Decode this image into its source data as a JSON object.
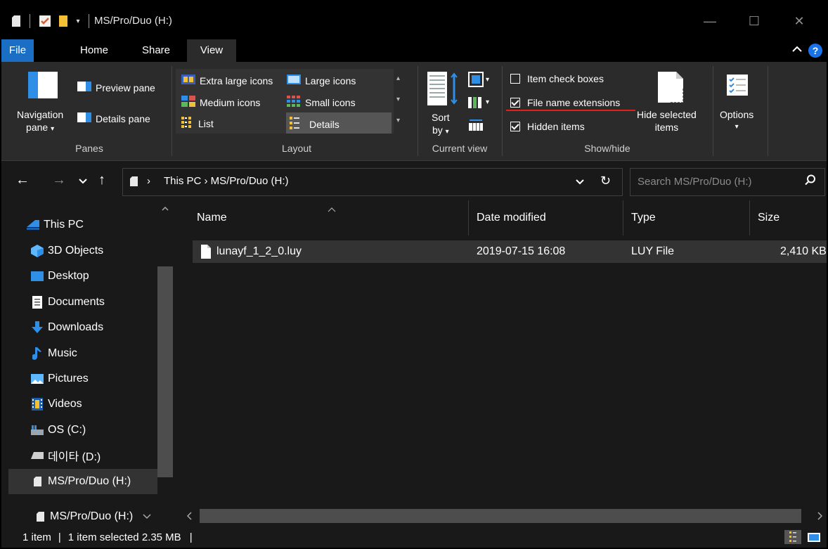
{
  "window": {
    "title": "MS/Pro/Duo (H:)",
    "minimize_glyph": "—",
    "maximize_glyph": "☐",
    "close_glyph": "✕"
  },
  "ribbon_tabs": [
    "File",
    "Home",
    "Share",
    "View"
  ],
  "ribbon_active_tab": "View",
  "ribbon_collapse_glyph": "^",
  "help_glyph": "?",
  "panes": {
    "label": "Panes",
    "navigation_pane_line1": "Navigation",
    "navigation_pane_line2": "pane",
    "preview_pane": "Preview pane",
    "details_pane": "Details pane"
  },
  "layout": {
    "label": "Layout",
    "extra_large": "Extra large icons",
    "large": "Large icons",
    "medium": "Medium icons",
    "small": "Small icons",
    "list": "List",
    "details": "Details"
  },
  "current_view": {
    "label": "Current view",
    "sort_line1": "Sort",
    "sort_line2": "by"
  },
  "show_hide": {
    "label": "Show/hide",
    "item_check_boxes": "Item check boxes",
    "file_name_extensions": "File name extensions",
    "hidden_items": "Hidden items",
    "hide_selected_line1": "Hide selected",
    "hide_selected_line2": "items",
    "options": "Options",
    "item_check_boxes_checked": false,
    "file_name_extensions_checked": true,
    "hidden_items_checked": true
  },
  "address": {
    "path": "This PC  ›  MS/Pro/Duo (H:)",
    "search_placeholder": "Search MS/Pro/Duo (H:)"
  },
  "nav_pane": {
    "items": [
      {
        "label": "This PC",
        "icon": "pc-icon"
      },
      {
        "label": "3D Objects",
        "icon": "3d-objects-icon"
      },
      {
        "label": "Desktop",
        "icon": "desktop-icon"
      },
      {
        "label": "Documents",
        "icon": "documents-icon"
      },
      {
        "label": "Downloads",
        "icon": "downloads-icon"
      },
      {
        "label": "Music",
        "icon": "music-icon"
      },
      {
        "label": "Pictures",
        "icon": "pictures-icon"
      },
      {
        "label": "Videos",
        "icon": "videos-icon"
      },
      {
        "label": "OS (C:)",
        "icon": "drive-c-icon"
      },
      {
        "label": "데이타 (D:)",
        "icon": "drive-d-icon"
      },
      {
        "label": "MS/Pro/Duo (H:)",
        "icon": "sd-card-icon"
      }
    ],
    "bottom_item": "MS/Pro/Duo (H:)"
  },
  "file_list": {
    "columns": [
      "Name",
      "Date modified",
      "Type",
      "Size"
    ],
    "rows": [
      {
        "name": "lunayf_1_2_0.luy",
        "date": "2019-07-15 16:08",
        "type": "LUY File",
        "size": "2,410 KB"
      }
    ]
  },
  "status_bar": {
    "count": "1 item",
    "selection": "1 item selected  2.35 MB"
  },
  "colors": {
    "accent": "#1a6fc4",
    "folder_yellow": "#f2c037",
    "underline_red": "#e0201b"
  }
}
